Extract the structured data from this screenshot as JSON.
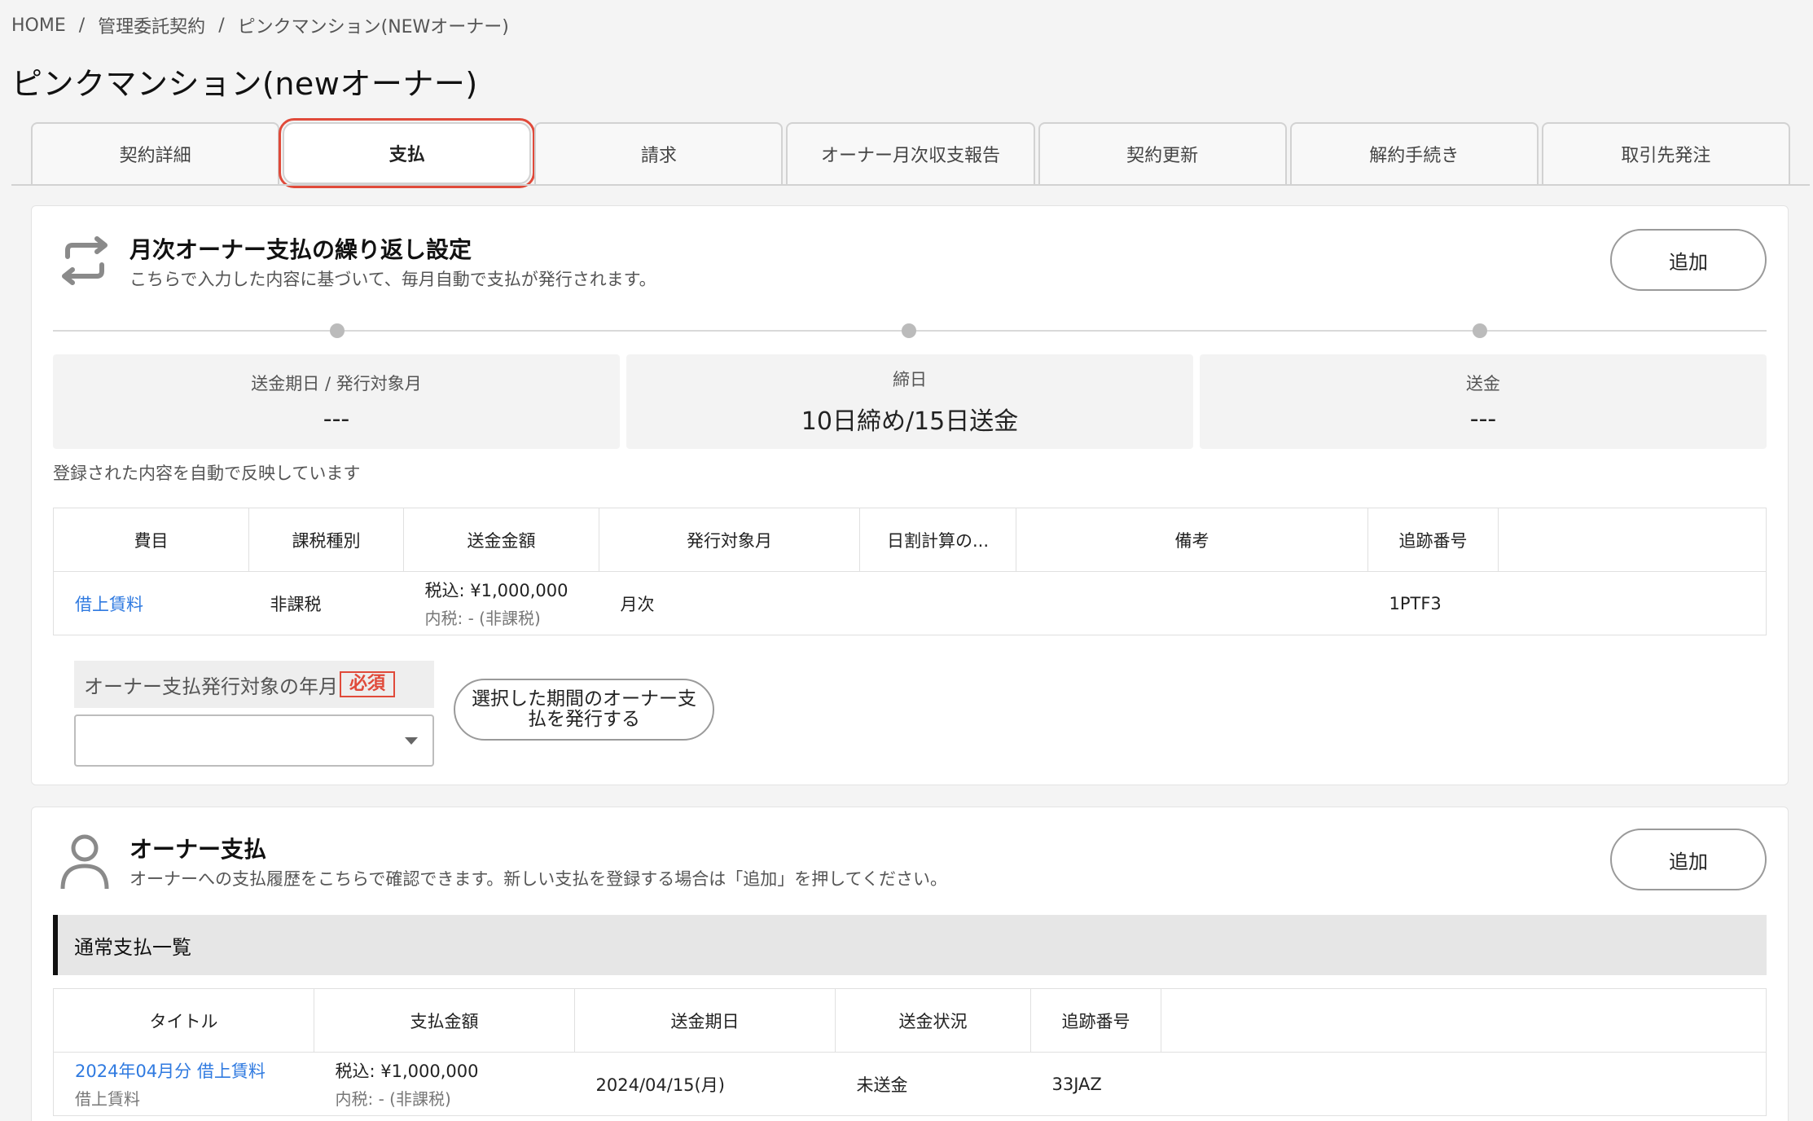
{
  "breadcrumb": [
    "HOME",
    "管理委託契約",
    "ピンクマンション(NEWオーナー)"
  ],
  "page_title": "ピンクマンション(newオーナー)",
  "tabs": [
    {
      "label": "契約詳細",
      "active": false
    },
    {
      "label": "支払",
      "active": true
    },
    {
      "label": "請求",
      "active": false
    },
    {
      "label": "オーナー月次収支報告",
      "active": false
    },
    {
      "label": "契約更新",
      "active": false
    },
    {
      "label": "解約手続き",
      "active": false
    },
    {
      "label": "取引先発注",
      "active": false
    }
  ],
  "recurring": {
    "title": "月次オーナー支払の繰り返し設定",
    "description": "こちらで入力した内容に基づいて、毎月自動で支払が発行されます。",
    "add_label": "追加",
    "summary": [
      {
        "label": "送金期日 / 発行対象月",
        "value": "---"
      },
      {
        "label": "締日",
        "value": "10日締め/15日送金"
      },
      {
        "label": "送金",
        "value": "---"
      }
    ],
    "note": "登録された内容を自動で反映しています",
    "table": {
      "headers": [
        "費目",
        "課税種別",
        "送金金額",
        "発行対象月",
        "日割計算の...",
        "備考",
        "追跡番号",
        ""
      ],
      "row": {
        "item": "借上賃料",
        "tax_type": "非課税",
        "amount": "税込: ¥1,000,000",
        "amount_sub": "内税: - (非課税)",
        "target_month": "月次",
        "prorate": "",
        "remarks": "",
        "tracking": "1PTF3"
      }
    },
    "form_label": "オーナー支払発行対象の年月",
    "required_badge": "必須",
    "select_value": "",
    "issue_button": "選択した期間のオーナー支払を発行する"
  },
  "owner_payment": {
    "title": "オーナー支払",
    "description": "オーナーへの支払履歴をこちらで確認できます。新しい支払を登録する場合は「追加」を押してください。",
    "add_label": "追加",
    "list_title": "通常支払一覧",
    "table": {
      "headers": [
        "タイトル",
        "支払金額",
        "送金期日",
        "送金状況",
        "追跡番号",
        ""
      ],
      "row": {
        "title": "2024年04月分 借上賃料",
        "title_sub": "借上賃料",
        "amount": "税込: ¥1,000,000",
        "amount_sub": "内税: - (非課税)",
        "due_date": "2024/04/15(月)",
        "status": "未送金",
        "tracking": "33JAZ"
      }
    }
  }
}
